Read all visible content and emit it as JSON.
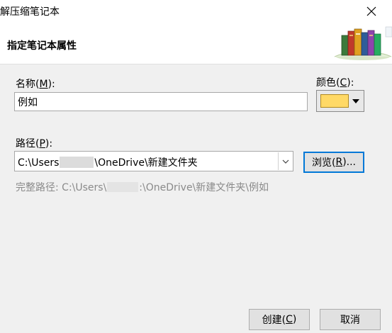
{
  "window": {
    "title": "解压缩笔记本",
    "close_icon": "close-icon"
  },
  "header": {
    "title": "指定笔记本属性",
    "illustration_icon": "books-icon"
  },
  "name_field": {
    "label_prefix": "名称(",
    "label_key": "M",
    "label_suffix": "):",
    "value": "例如"
  },
  "color_field": {
    "label_prefix": "颜色(",
    "label_key": "C",
    "label_suffix": "):",
    "swatch_color": "#ffd966"
  },
  "path_field": {
    "label_prefix": "路径(",
    "label_key": "P",
    "label_suffix": "):",
    "value_start": "C:\\Users",
    "value_end": "\\OneDrive\\新建文件夹"
  },
  "browse_button": {
    "label_prefix": "浏览(",
    "label_key": "R",
    "label_suffix": ")..."
  },
  "full_path": {
    "prefix": "完整路径: C:\\Users\\",
    "suffix": ":\\OneDrive\\新建文件夹\\例如"
  },
  "footer": {
    "create_prefix": "创建(",
    "create_key": "C",
    "create_suffix": ")",
    "cancel_label": "取消"
  },
  "colors": {
    "focus_border": "#0078d7",
    "muted_text": "#8a8a8a"
  }
}
